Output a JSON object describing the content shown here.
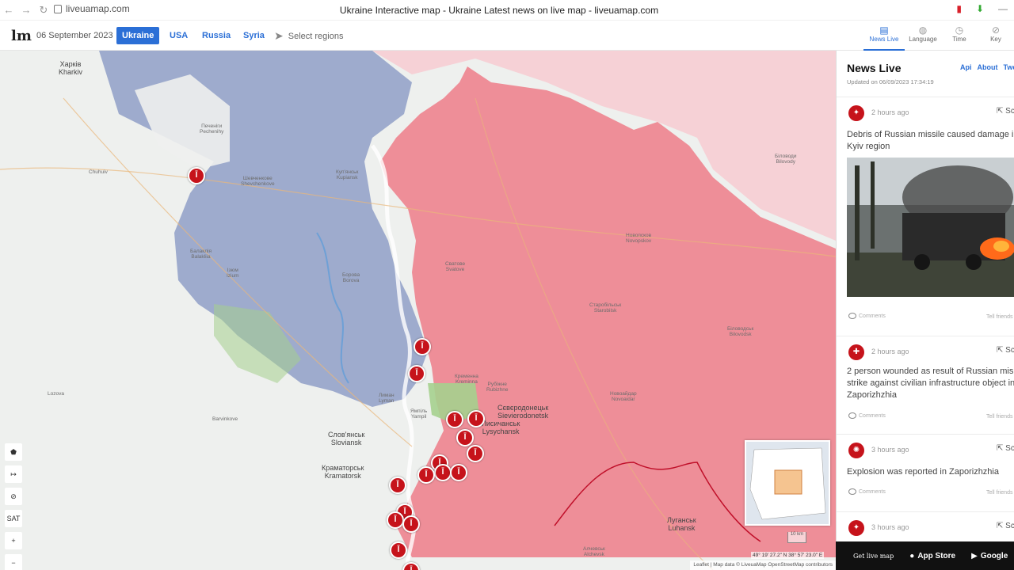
{
  "browser": {
    "url": "liveuamap.com",
    "page_title": "Ukraine Interactive map - Ukraine Latest news on live map - liveuamap.com"
  },
  "header": {
    "logo": "lm",
    "date": "06 September 2023",
    "tabs": [
      {
        "label": "Ukraine",
        "active": true
      },
      {
        "label": "USA",
        "active": false
      },
      {
        "label": "Russia",
        "active": false
      },
      {
        "label": "Syria",
        "active": false
      }
    ],
    "select_regions": "Select regions",
    "tools": [
      {
        "label": "News Live",
        "icon": "news-icon",
        "active": true
      },
      {
        "label": "Language",
        "icon": "globe-icon",
        "active": false
      },
      {
        "label": "Time",
        "icon": "clock-icon",
        "active": false
      },
      {
        "label": "Key",
        "icon": "compass-icon",
        "active": false
      }
    ]
  },
  "map": {
    "places": [
      {
        "name": "Харків\nKharkiv",
        "big": true
      },
      {
        "name": "Печеніги\nPechenihy"
      },
      {
        "name": "Шевченкове\nShevchenkove"
      },
      {
        "name": "Куп'янськ\nKupiansk"
      },
      {
        "name": "Балаклія\nBalakliia"
      },
      {
        "name": "Ізюм\nIzium"
      },
      {
        "name": "Борова\nBorova"
      },
      {
        "name": "Сватове\nSvatove"
      },
      {
        "name": "Кременна\nKreminna"
      },
      {
        "name": "Рубіжне\nRubizhne"
      },
      {
        "name": "Сєвєродонецьк\nSievierodonetsk",
        "big": true
      },
      {
        "name": "Лисичанськ\nLysychansk",
        "big": true
      },
      {
        "name": "Старобільськ\nStarobilsk"
      },
      {
        "name": "Біловодськ\nBilovodsk"
      },
      {
        "name": "Новоайдар\nNovoaidar"
      },
      {
        "name": "Слов'янськ\nSloviansk",
        "big": true
      },
      {
        "name": "Краматорськ\nKramatorsk",
        "big": true
      },
      {
        "name": "Лиман\nLyman"
      },
      {
        "name": "Ямпіль\nYampil"
      },
      {
        "name": "Луганськ\nLuhansk",
        "big": true
      },
      {
        "name": "Алчевськ\nAlchevsk"
      },
      {
        "name": "Новопсков\nNovopskov"
      },
      {
        "name": "Біловоди\nBilovody"
      },
      {
        "name": "Chuhuiv"
      },
      {
        "name": "Lozova"
      },
      {
        "name": "Barvinkove"
      }
    ],
    "marker_count": 20,
    "map_tools": [
      "pentagon-icon",
      "arrows-icon",
      "eye-off-icon",
      "SAT",
      "+",
      "−"
    ],
    "scale_label": "10 km",
    "coordinates": "49° 19' 27.2\" N 38° 57' 23.0\" E",
    "attribution": "Leaflet | Map data © LiveuaMap OpenStreetMap contributors",
    "colors": {
      "occupied": "#ee8e98",
      "liberated": "#8f9fc7",
      "russia": "#f6d1d6",
      "contested": "#a5d08e"
    }
  },
  "news": {
    "title": "News Live",
    "updated": "Updated on 06/09/2023 17:34:19",
    "links": [
      "Api",
      "About",
      "Twe"
    ],
    "items": [
      {
        "time": "2 hours ago",
        "icon": "missile-icon",
        "share": "Sc",
        "text_lines": [
          "Debris of Russian missile caused damage in",
          "Kyiv region"
        ],
        "has_photo": true,
        "comments": "Comments",
        "tell": "Tell friends"
      },
      {
        "time": "2 hours ago",
        "icon": "wounded-icon",
        "share": "Sc",
        "text_lines": [
          "2 person wounded as result of Russian mis",
          "strike against civilian infrastructure object in",
          "Zaporizhzhia"
        ],
        "comments": "Comments",
        "tell": "Tell friends"
      },
      {
        "time": "3 hours ago",
        "icon": "explosion-icon",
        "share": "Sc",
        "text_lines": [
          "Explosion was reported in Zaporizhzhia"
        ],
        "comments": "Comments",
        "tell": "Tell friends"
      },
      {
        "time": "3 hours ago",
        "icon": "missile-icon",
        "share": "Sc"
      }
    ]
  },
  "footer": {
    "get_live_map": "Get live map",
    "app_store": "App Store",
    "google_play": "Google"
  }
}
